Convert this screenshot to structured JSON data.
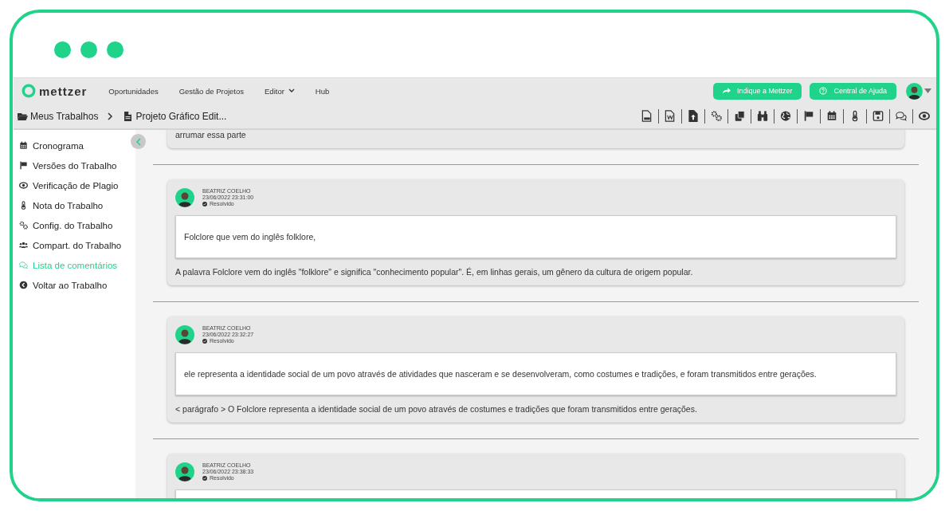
{
  "brand": {
    "name": "mettzer"
  },
  "nav": [
    {
      "label": "Oportunidades",
      "dropdown": false
    },
    {
      "label": "Gestão de Projetos",
      "dropdown": false
    },
    {
      "label": "Editor",
      "dropdown": true
    },
    {
      "label": "Hub",
      "dropdown": false
    }
  ],
  "header_buttons": [
    {
      "label": "Indique a Mettzer",
      "kind": "share"
    },
    {
      "label": "Central de Ajuda",
      "kind": "help"
    }
  ],
  "breadcrumb": [
    {
      "label": "Meus Trabalhos",
      "kind": "folder"
    },
    {
      "label": "Projeto Gráfico Edit...",
      "kind": "file"
    }
  ],
  "sidebar": {
    "items": [
      {
        "label": "Cronograma",
        "kind": "calendar",
        "selected": false
      },
      {
        "label": "Versões do Trabalho",
        "kind": "flag",
        "selected": false
      },
      {
        "label": "Verificação de Plagio",
        "kind": "eye",
        "selected": false
      },
      {
        "label": "Nota do Trabalho",
        "kind": "thermometer",
        "selected": false
      },
      {
        "label": "Config. do Trabalho",
        "kind": "gears",
        "selected": false
      },
      {
        "label": "Compart. do Trabalho",
        "kind": "users",
        "selected": false
      },
      {
        "label": "Lista de comentários",
        "kind": "comments",
        "selected": true
      },
      {
        "label": "Voltar ao Trabalho",
        "kind": "back",
        "selected": false
      }
    ]
  },
  "comments": [
    {
      "reply": "arrumar essa parte"
    },
    {
      "author": "BEATRIZ COELHO",
      "date": "23/06/2022 23:31:00",
      "status": "Resolvido",
      "quote": "Folclore que vem do inglês folklore,",
      "reply": "A palavra Folclore vem do inglês \"folklore\" e significa \"conhecimento popular\". É, em linhas gerais, um gênero da cultura de origem popular."
    },
    {
      "author": "BEATRIZ COELHO",
      "date": "23/06/2022 23:32:27",
      "status": "Resolvido",
      "quote": "ele representa a identidade social de um povo através de atividades que nasceram e se desenvolveram, como costumes e tradições, e foram transmitidos entre gerações.",
      "reply": "< parágrafo > O Folclore representa a identidade social de um povo através de costumes e tradições que foram transmitidos entre gerações."
    },
    {
      "author": "BEATRIZ COELHO",
      "date": "23/06/2022 23:38:33",
      "status": "Resolvido"
    }
  ]
}
